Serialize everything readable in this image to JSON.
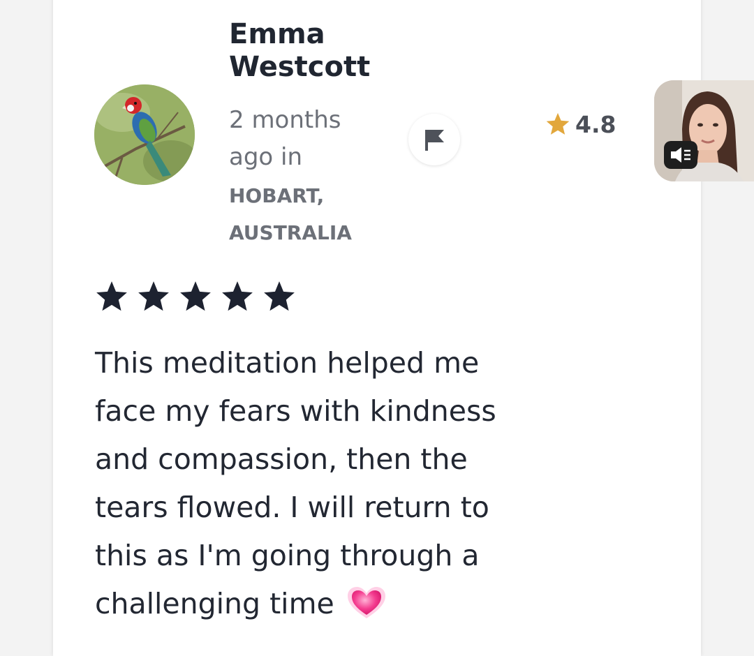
{
  "reviewer": {
    "name": "Emma Westcott",
    "time_ago": "2 months ago in",
    "location": "HOBART, AUSTRALIA",
    "avatar_icon": "rosella-bird-avatar"
  },
  "actions": {
    "flag_icon": "flag-icon"
  },
  "teacher_rating": {
    "value": "4.8",
    "star_color": "#e2a73c"
  },
  "video_pip": {
    "mute_icon": "speaker-muted-icon"
  },
  "review": {
    "stars": 5,
    "max_stars": 5,
    "star_color": "#1d2230",
    "text": "This meditation helped me face my fears with kindness and compassion, then the tears flowed. I will return to this as I'm going through a challenging time",
    "emoji": "growing-heart-emoji"
  }
}
